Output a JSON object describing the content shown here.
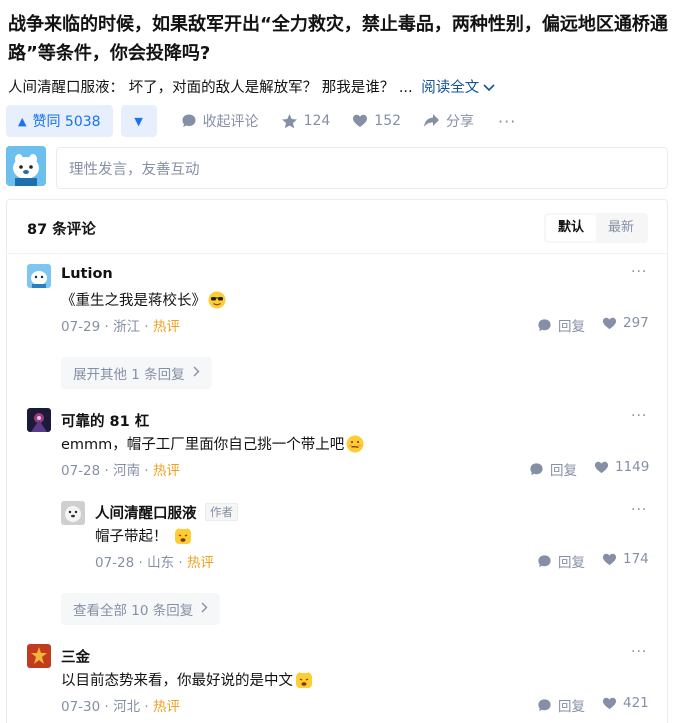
{
  "question": {
    "title": "战争来临的时候，如果敌军开出“全力救灾，禁止毒品，两种性别，偏远地区通桥通路”等条件，你会投降吗?"
  },
  "excerpt": {
    "text": "人间清醒口服液： 坏了，对面的敌人是解放军？ 那我是谁？ ...",
    "read_more": "阅读全文"
  },
  "actions": {
    "upvote": "赞同 5038",
    "collapse_comments": "收起评论",
    "stars": "124",
    "likes": "152",
    "share": "分享"
  },
  "comment_input": {
    "placeholder": "理性发言，友善互动"
  },
  "comments_panel": {
    "count": "87 条评论",
    "sort_default": "默认",
    "sort_latest": "最新"
  },
  "comments": [
    {
      "name": "Lution",
      "text": "《重生之我是蒋校长》",
      "date": "07-29",
      "location": "浙江",
      "hot": "热评",
      "reply": "回复",
      "likes": "297",
      "expand": "展开其他 1 条回复"
    },
    {
      "name": "可靠的 81 杠",
      "text": "emmm，帽子工厂里面你自己挑一个带上吧",
      "date": "07-28",
      "location": "河南",
      "hot": "热评",
      "reply": "回复",
      "likes": "1149",
      "child": {
        "name": "人间清醒口服液",
        "author_tag": "作者",
        "text": "帽子带起！",
        "date": "07-28",
        "location": "山东",
        "hot": "热评",
        "reply": "回复",
        "likes": "174"
      },
      "expand": "查看全部 10 条回复"
    },
    {
      "name": "三金",
      "text": "以目前态势来看，你最好说的是中文",
      "date": "07-30",
      "location": "河北",
      "hot": "热评",
      "reply": "回复",
      "likes": "421"
    }
  ],
  "colors": {
    "brand_blue": "#1772f6",
    "muted": "#8590a6",
    "hot": "#f0a020"
  }
}
